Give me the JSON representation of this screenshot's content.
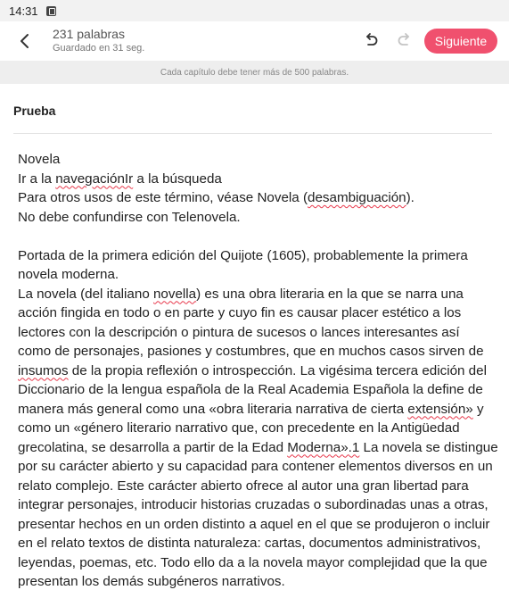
{
  "status_bar": {
    "time": "14:31"
  },
  "toolbar": {
    "word_count": "231 palabras",
    "save_status": "Guardado en 31 seg.",
    "next_label": "Siguiente",
    "accent_color": "#f0506e"
  },
  "banner": {
    "text": "Cada capítulo debe tener más de 500 palabras."
  },
  "chapter": {
    "title": "Prueba",
    "body": {
      "l1": "Novela",
      "l2a": "Ir a la ",
      "l2b": "navegaciónIr",
      "l2c": " a la búsqueda",
      "l3a": "Para otros usos de este término, véase Novela (",
      "l3b": "desambiguación",
      "l3c": ").",
      "l4": "No debe confundirse con Telenovela.",
      "l5": "Portada de la primera edición del Quijote (1605), probablemente la primera",
      "l6": "novela moderna.",
      "l7a": "La novela (del italiano ",
      "l7b": "novella",
      "l7c": ") es una obra literaria en la que se narra una",
      "l8": "acción fingida en todo o en parte y cuyo fin es causar placer estético a los",
      "l9": "lectores con la descripción o pintura de sucesos o lances interesantes así",
      "l10": "como de personajes, pasiones y costumbres, que en muchos casos sirven de",
      "l11a": "insumos",
      "l11b": " de la propia reflexión o introspección. La vigésima tercera edición del",
      "l12": "Diccionario de la lengua española de la Real Academia Española la define de",
      "l13": "manera más general como una «obra literaria narrativa de cierta ",
      "l13b": "extensión»",
      "l13c": " y",
      "l14": "como un «género literario narrativo que, con precedente en la Antigüedad",
      "l15a": "grecolatina, se desarrolla a partir de la Edad ",
      "l15b": "Moderna».1",
      "l15c": " La novela se distingue",
      "l16": "por su carácter abierto y su capacidad para contener elementos diversos en un",
      "l17": "relato complejo. Este carácter abierto ofrece al autor una gran libertad para",
      "l18": "integrar personajes, introducir historias cruzadas o subordinadas unas a otras,",
      "l19": "presentar hechos en un orden distinto a aquel en el que se produjeron o incluir",
      "l20": "en el relato textos de distinta naturaleza: cartas, documentos administrativos,",
      "l21": "leyendas, poemas, etc. Todo ello da a la novela mayor complejidad que la que",
      "l22": "presentan los demás subgéneros narrativos."
    }
  }
}
